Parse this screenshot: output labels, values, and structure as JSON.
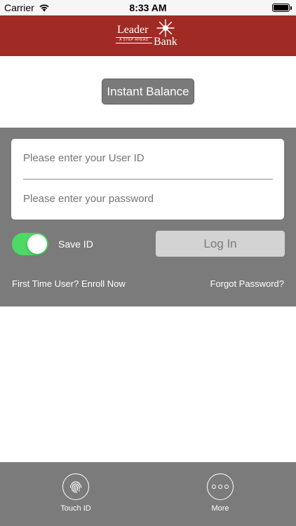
{
  "status_bar": {
    "carrier": "Carrier",
    "time": "8:33 AM",
    "wifi_icon": "wifi-icon",
    "battery_icon": "battery-icon",
    "battery_level": 1.0
  },
  "header": {
    "logo_text_top": "Leader",
    "logo_text_bottom": "Bank",
    "logo_tagline": "A STEP AHEAD",
    "background_color": "#a02b24"
  },
  "instant_balance": {
    "label": "Instant Balance"
  },
  "login": {
    "user_id_placeholder": "Please enter your User ID",
    "password_placeholder": "Please enter your password",
    "save_id_label": "Save ID",
    "save_id_enabled": true,
    "toggle_color": "#4cd964",
    "login_button_label": "Log In",
    "enroll_link": "First Time User? Enroll Now",
    "forgot_link": "Forgot Password?"
  },
  "tab_bar": {
    "items": [
      {
        "label": "Touch ID",
        "icon": "fingerprint-icon"
      },
      {
        "label": "More",
        "icon": "more-dots-icon"
      }
    ]
  }
}
